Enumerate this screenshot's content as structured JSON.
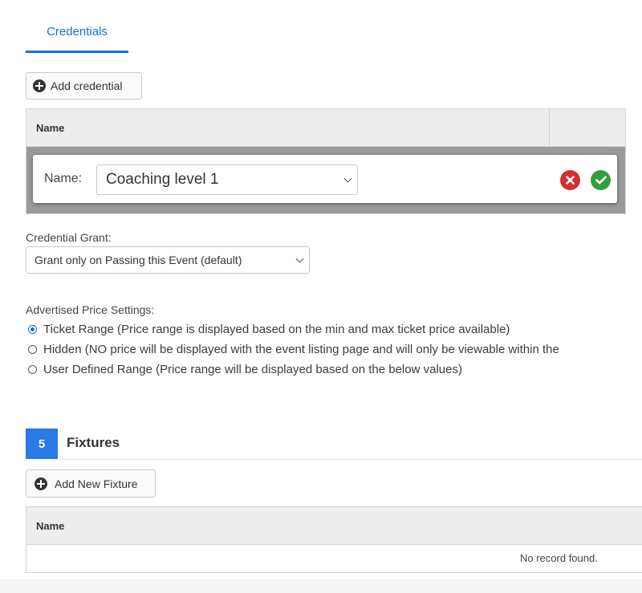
{
  "tabs": {
    "active_label": "Credentials"
  },
  "credentials": {
    "add_button_label": "Add credential",
    "table": {
      "column_name": "Name"
    },
    "edit_row": {
      "name_label": "Name:",
      "selected_value": "Coaching level 1"
    }
  },
  "credential_grant": {
    "label": "Credential Grant:",
    "selected_value": "Grant only on Passing this Event (default)"
  },
  "price_settings": {
    "label": "Advertised Price Settings:",
    "options": [
      {
        "label": "Ticket Range (Price range is displayed based on the min and max ticket price available)",
        "checked": true
      },
      {
        "label": "Hidden (NO price will be displayed with the event listing page and will only be viewable within the",
        "checked": false
      },
      {
        "label": "User Defined Range (Price range will be displayed based on the below values)",
        "checked": false
      }
    ]
  },
  "fixtures": {
    "step_number": "5",
    "title": "Fixtures",
    "add_button_label": "Add New Fixture",
    "table": {
      "column_name": "Name",
      "empty_message": "No record found."
    }
  },
  "colors": {
    "accent": "#1a6fd6",
    "cancel": "#d32f2f",
    "confirm": "#2e9e3e",
    "badge": "#2979e6"
  },
  "icons": {
    "add": "plus-circle-icon",
    "cancel": "x-circle-icon",
    "confirm": "check-circle-icon",
    "dropdown": "chevron-down-icon"
  }
}
